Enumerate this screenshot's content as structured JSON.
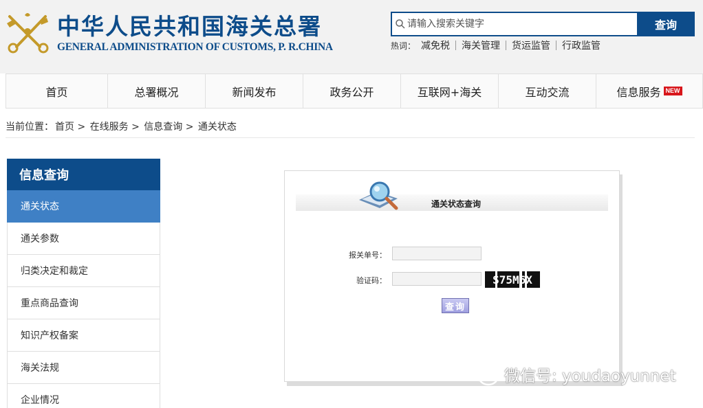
{
  "header": {
    "title_cn": "中华人民共和国海关总署",
    "title_en": "GENERAL ADMINISTRATION OF CUSTOMS, P. R.CHINA"
  },
  "search": {
    "placeholder": "请输入搜索关键字",
    "button_label": "查询",
    "hot_label": "热词：",
    "hot_terms": [
      "减免税",
      "海关管理",
      "货运监管",
      "行政监管"
    ]
  },
  "nav": {
    "items": [
      {
        "label": "首页"
      },
      {
        "label": "总署概况"
      },
      {
        "label": "新闻发布"
      },
      {
        "label": "政务公开"
      },
      {
        "label": "互联网+海关"
      },
      {
        "label": "互动交流"
      },
      {
        "label": "信息服务",
        "badge": "NEW"
      }
    ]
  },
  "breadcrumb": {
    "prefix": "当前位置：",
    "items": [
      "首页",
      "在线服务",
      "信息查询",
      "通关状态"
    ],
    "separator": ">"
  },
  "sidebar": {
    "title": "信息查询",
    "items": [
      {
        "label": "通关状态",
        "active": true
      },
      {
        "label": "通关参数"
      },
      {
        "label": "归类决定和裁定"
      },
      {
        "label": "重点商品查询"
      },
      {
        "label": "知识产权备案"
      },
      {
        "label": "海关法规"
      },
      {
        "label": "企业情况"
      }
    ]
  },
  "query_panel": {
    "title": "通关状态查询",
    "declaration_label": "报关单号：",
    "declaration_value": "",
    "captcha_label": "验证码：",
    "captcha_value": "",
    "captcha_text": "S75M6X",
    "submit_label": "查询"
  },
  "watermark": {
    "text": "微信号: youdaoyunnet"
  },
  "colors": {
    "brand_blue": "#0d4c8a",
    "active_blue": "#3f80c5",
    "badge_red": "#d8161b"
  }
}
